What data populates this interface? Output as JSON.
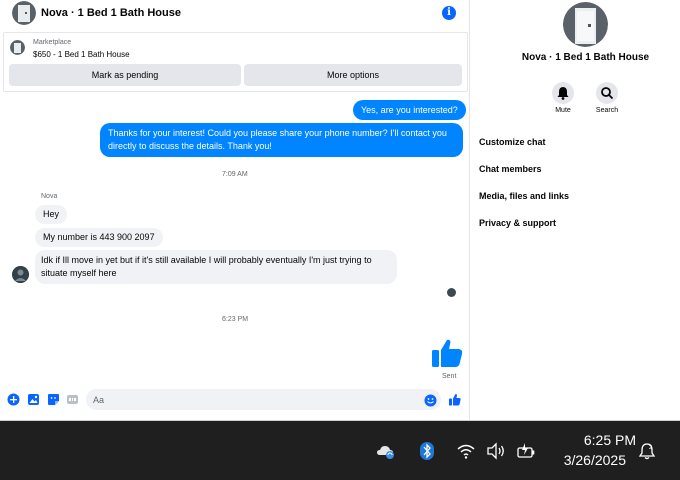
{
  "header": {
    "title": "Nova · 1 Bed 1 Bath House"
  },
  "listing": {
    "source": "Marketplace",
    "price_title": "$650 - 1 Bed 1 Bath House",
    "mark_pending_label": "Mark as pending",
    "more_options_label": "More options"
  },
  "messages": {
    "out_1": "Yes, are you interested?",
    "out_2": "Thanks for your interest! Could you please share your phone number? I'll contact you directly to discuss the details. Thank you!",
    "timestamp_1": "7:09 AM",
    "sender_name": "Nova",
    "in_1": "Hey",
    "in_2": "My number is 443 900 2097",
    "in_3": "Idk if Ill move in yet but if it's still available I will probably eventually I'm just trying to situate myself here",
    "timestamp_2": "6:23 PM",
    "sent_status": "Sent"
  },
  "composer": {
    "placeholder": "Aa"
  },
  "details": {
    "title": "Nova · 1 Bed 1 Bath House",
    "mute_label": "Mute",
    "search_label": "Search",
    "menu": [
      "Customize chat",
      "Chat members",
      "Media, files and links",
      "Privacy & support"
    ]
  },
  "taskbar": {
    "time": "6:25 PM",
    "date": "3/26/2025"
  },
  "colors": {
    "accent": "#0084ff",
    "brand_blue": "#0866ff",
    "bubble_in": "#f0f2f5",
    "taskbar": "#1f1f1f"
  }
}
